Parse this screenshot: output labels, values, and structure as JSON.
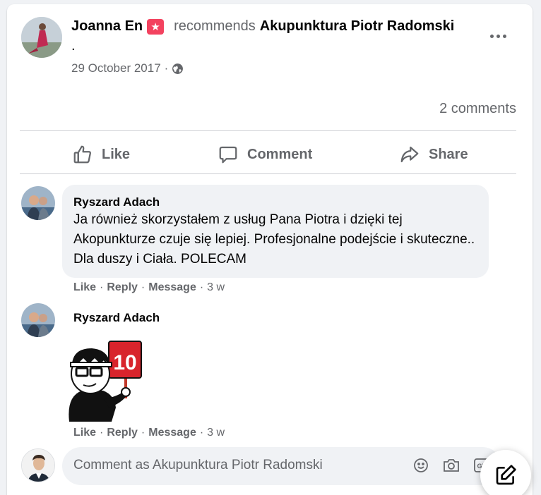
{
  "post": {
    "author": "Joanna En",
    "action": "recommends",
    "page": "Akupunktura Piotr Radomski",
    "trailing_dot": ".",
    "date": "29 October 2017",
    "date_separator": "·",
    "audience_icon": "globe-icon",
    "more_icon": "more-options-icon",
    "comment_count": "2 comments"
  },
  "actions": {
    "like": "Like",
    "comment": "Comment",
    "share": "Share"
  },
  "comments": [
    {
      "author": "Ryszard Adach",
      "text": "Ja również skorzystałem z usług Pana Piotra i dzięki tej Akopunkturze czuje się lepiej. Profesjonalne podejście i skuteczne.. Dla duszy i Ciała. POLECAM",
      "like": "Like",
      "reply": "Reply",
      "message": "Message",
      "time": "3 w",
      "sep": "·"
    },
    {
      "author": "Ryszard Adach",
      "sticker": "sticker-10-sign",
      "sticker_text": "10",
      "like": "Like",
      "reply": "Reply",
      "message": "Message",
      "time": "3 w",
      "sep": "·"
    }
  ],
  "composer": {
    "placeholder": "Comment as Akupunktura Piotr Radomski",
    "icons": [
      "emoji-icon",
      "camera-icon",
      "gif-icon"
    ]
  },
  "colors": {
    "text_primary": "#050505",
    "text_secondary": "#65676b",
    "bubble": "#f0f2f5",
    "recommend_badge": "#f3425f"
  }
}
